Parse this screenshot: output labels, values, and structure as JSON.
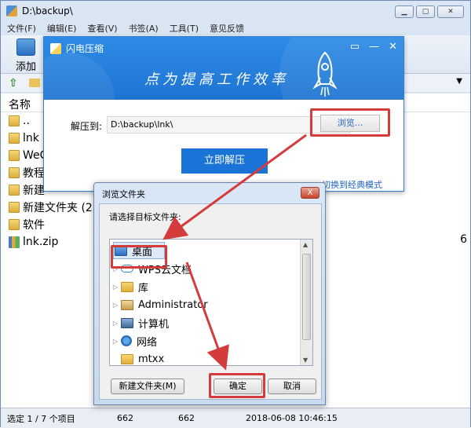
{
  "main_window": {
    "title": "D:\\backup\\",
    "menu": [
      "文件(F)",
      "编辑(E)",
      "查看(V)",
      "书签(A)",
      "工具(T)",
      "意见反馈"
    ],
    "toolbar": {
      "add_label": "添加"
    },
    "list_header": {
      "name": "名称"
    },
    "files": [
      {
        "name": "..",
        "type": "folder"
      },
      {
        "name": "lnk",
        "type": "folder"
      },
      {
        "name": "WeC",
        "type": "folder"
      },
      {
        "name": "教程",
        "type": "folder"
      },
      {
        "name": "新建",
        "type": "folder"
      },
      {
        "name": "新建文件夹 (2)",
        "type": "folder"
      },
      {
        "name": "软件",
        "type": "folder"
      },
      {
        "name": "lnk.zip",
        "type": "zip"
      }
    ],
    "edge_value": "6",
    "status": {
      "selection": "选定 1 / 7 个项目",
      "size": "662",
      "packed": "662",
      "modified": "2018-06-08 10:46:15"
    }
  },
  "flash_dialog": {
    "title": "闪电压缩",
    "slogan": "点为提高工作效率",
    "extract_to_label": "解压到:",
    "path_value": "D:\\backup\\lnk\\",
    "browse_label": "浏览...",
    "extract_button": "立即解压",
    "classic_mode_link": "切换到经典模式"
  },
  "browse_dialog": {
    "title": "浏览文件夹",
    "close_label": "X",
    "prompt": "请选择目标文件夹:",
    "tree": [
      {
        "label": "桌面",
        "icon": "desktop-icon",
        "selected": true
      },
      {
        "label": "WPS云文档",
        "icon": "cloud-icon"
      },
      {
        "label": "库",
        "icon": "library-icon"
      },
      {
        "label": "Administrator",
        "icon": "user-folder-icon"
      },
      {
        "label": "计算机",
        "icon": "computer-icon"
      },
      {
        "label": "网络",
        "icon": "network-icon"
      },
      {
        "label": "mtxx",
        "icon": "folder-icon"
      }
    ],
    "new_folder_button": "新建文件夹(M)",
    "ok_button": "确定",
    "cancel_button": "取消"
  },
  "colors": {
    "accent_blue": "#1a73d6",
    "highlight_red": "#d43b3b"
  }
}
